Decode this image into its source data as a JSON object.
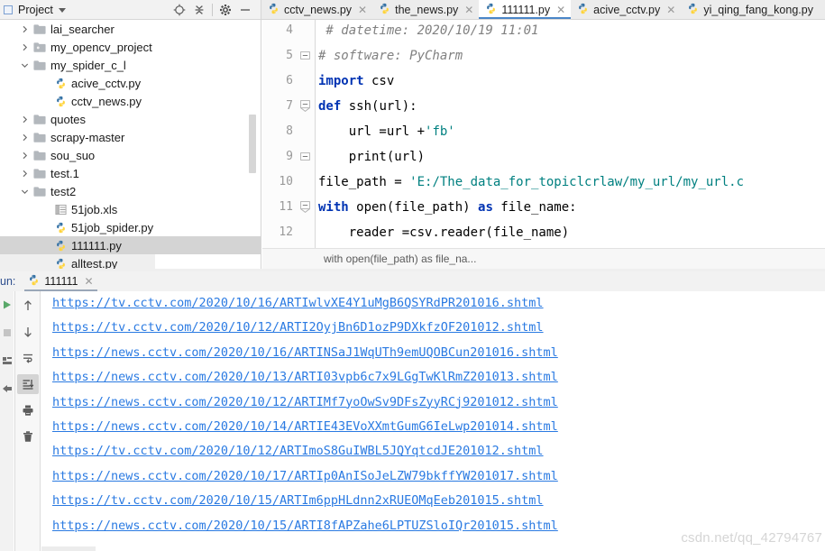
{
  "project_panel": {
    "title": "Project",
    "dropdown_icon": "chevron-down-icon",
    "tools": [
      "locate-icon",
      "collapse-all-icon",
      "settings-gear-icon",
      "minimize-icon"
    ],
    "tree": [
      {
        "label": "lai_searcher",
        "type": "folder",
        "arrow": "collapsed",
        "indent": 1,
        "state": "normal"
      },
      {
        "label": "my_opencv_project",
        "type": "folder-module",
        "arrow": "collapsed",
        "indent": 1,
        "state": "normal"
      },
      {
        "label": "my_spider_c_l",
        "type": "folder",
        "arrow": "expanded",
        "indent": 1,
        "state": "normal"
      },
      {
        "label": "acive_cctv.py",
        "type": "python",
        "arrow": "none",
        "indent": 2,
        "state": "normal"
      },
      {
        "label": "cctv_news.py",
        "type": "python",
        "arrow": "none",
        "indent": 2,
        "state": "normal"
      },
      {
        "label": "quotes",
        "type": "folder",
        "arrow": "collapsed",
        "indent": 1,
        "state": "normal"
      },
      {
        "label": "scrapy-master",
        "type": "folder",
        "arrow": "collapsed",
        "indent": 1,
        "state": "normal"
      },
      {
        "label": "sou_suo",
        "type": "folder",
        "arrow": "collapsed",
        "indent": 1,
        "state": "normal"
      },
      {
        "label": "test.1",
        "type": "folder",
        "arrow": "collapsed",
        "indent": 1,
        "state": "normal"
      },
      {
        "label": "test2",
        "type": "folder",
        "arrow": "expanded",
        "indent": 1,
        "state": "normal"
      },
      {
        "label": "51job.xls",
        "type": "excel",
        "arrow": "none",
        "indent": 2,
        "state": "normal"
      },
      {
        "label": "51job_spider.py",
        "type": "python",
        "arrow": "none",
        "indent": 2,
        "state": "normal"
      },
      {
        "label": "111111.py",
        "type": "python",
        "arrow": "none",
        "indent": 2,
        "state": "selected"
      },
      {
        "label": "alltest.py",
        "type": "python",
        "arrow": "none",
        "indent": 2,
        "state": "highlight"
      }
    ]
  },
  "editor_tabs": [
    {
      "label": "cctv_news.py",
      "active": false
    },
    {
      "label": "the_news.py",
      "active": false
    },
    {
      "label": "111111.py",
      "active": true
    },
    {
      "label": "acive_cctv.py",
      "active": false
    },
    {
      "label": "yi_qing_fang_kong.py",
      "active": false
    }
  ],
  "editor": {
    "lines": [
      {
        "num": "4",
        "fold": "none",
        "segments": [
          {
            "text": " # datetime: 2020/10/19 11:01",
            "style": "cmt"
          }
        ]
      },
      {
        "num": "5",
        "fold": "minus",
        "segments": [
          {
            "text": "# software: PyCharm",
            "style": "cmt"
          }
        ]
      },
      {
        "num": "6",
        "fold": "none",
        "segments": [
          {
            "text": "import",
            "style": "kw"
          },
          {
            "text": " csv",
            "style": "plain"
          }
        ]
      },
      {
        "num": "7",
        "fold": "region",
        "segments": [
          {
            "text": "def",
            "style": "kw"
          },
          {
            "text": " ssh(url):",
            "style": "plain"
          }
        ]
      },
      {
        "num": "8",
        "fold": "none",
        "segments": [
          {
            "text": "    url =url +",
            "style": "plain"
          },
          {
            "text": "'fb'",
            "style": "str2"
          }
        ]
      },
      {
        "num": "9",
        "fold": "minus",
        "segments": [
          {
            "text": "    print(url)",
            "style": "plain"
          }
        ]
      },
      {
        "num": "10",
        "fold": "none",
        "segments": [
          {
            "text": "file_path = ",
            "style": "plain"
          },
          {
            "text": "'E:/The_data_for_topiclcrlaw/my_url/my_url.c",
            "style": "str2"
          }
        ]
      },
      {
        "num": "11",
        "fold": "region",
        "segments": [
          {
            "text": "with",
            "style": "kw"
          },
          {
            "text": " open(file_path) ",
            "style": "plain"
          },
          {
            "text": "as",
            "style": "kw"
          },
          {
            "text": " file_name:",
            "style": "plain"
          }
        ]
      },
      {
        "num": "12",
        "fold": "none",
        "segments": [
          {
            "text": "    reader =csv.reader(file_name)",
            "style": "plain"
          }
        ]
      }
    ],
    "breadcrumb": "with open(file_path) as file_na..."
  },
  "run_panel": {
    "label": "un:",
    "tab_name": "111111",
    "tab_icon": "python-icon",
    "tab_close": "close-icon",
    "left_tools": [
      "run-icon",
      "stop-icon",
      "rerun-icon",
      "pin-icon"
    ],
    "side_tools": [
      {
        "icon": "arrow-up-icon",
        "active": false
      },
      {
        "icon": "arrow-down-icon",
        "active": false
      },
      {
        "icon": "soft-wrap-icon",
        "active": false
      },
      {
        "icon": "scroll-to-end-icon",
        "active": true
      },
      {
        "icon": "print-icon",
        "active": false
      },
      {
        "icon": "trash-icon",
        "active": false
      }
    ],
    "console_output": [
      "https://tv.cctv.com/2020/10/16/ARTIwlvXE4Y1uMgB6QSYRdPR201016.shtml",
      "https://tv.cctv.com/2020/10/12/ARTI2OyjBn6D1ozP9DXkfzOF201012.shtml",
      "https://news.cctv.com/2020/10/16/ARTINSaJ1WqUTh9emUQOBCun201016.shtml",
      "https://news.cctv.com/2020/10/13/ARTI03vpb6c7x9LGgTwKlRmZ201013.shtml",
      "https://news.cctv.com/2020/10/12/ARTIMf7yoOwSv9DFsZyyRCj9201012.shtml",
      "https://news.cctv.com/2020/10/14/ARTIE43EVoXXmtGumG6IeLwp201014.shtml",
      "https://tv.cctv.com/2020/10/12/ARTImoS8GuIWBL5JQYqtcdJE201012.shtml",
      "https://news.cctv.com/2020/10/17/ARTIp0AnISoJeLZW79bkffYW201017.shtml",
      "https://tv.cctv.com/2020/10/15/ARTIm6ppHLdnn2xRUEOMqEeb201015.shtml",
      "https://news.cctv.com/2020/10/15/ARTI8fAPZahe6LPTUZSloIQr201015.shtml"
    ],
    "watermark": "csdn.net/qq_42794767"
  },
  "colors": {
    "link": "#2a7ae2",
    "keyword": "#0033b3",
    "comment": "#808080",
    "string": "#008080",
    "tab_accent": "#4a86c8",
    "selection": "#d4d4d4",
    "panel_bg": "#f2f2f2"
  }
}
